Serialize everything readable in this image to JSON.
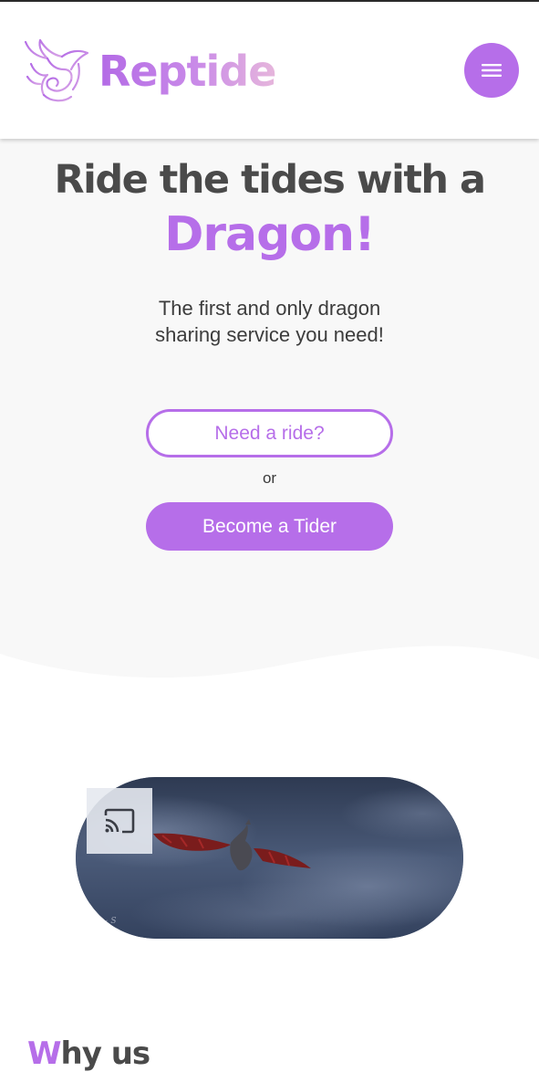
{
  "header": {
    "brand": "Reptide",
    "menu_icon": "hamburger-menu-icon",
    "logo_icon": "dragon-logo-icon"
  },
  "hero": {
    "headline": "Ride the tides with a",
    "headline_accent": "Dragon!",
    "subtitle": "The first and only dragon sharing service you need!",
    "cta_primary": "Need a ride?",
    "separator": "or",
    "cta_secondary": "Become a Tider"
  },
  "video": {
    "cast_icon": "cast-icon"
  },
  "why": {
    "first_letter": "W",
    "rest": "hy us"
  },
  "colors": {
    "accent": "#b66ee9",
    "text": "#4a4a4a",
    "hero_bg": "#f8f8f8"
  }
}
